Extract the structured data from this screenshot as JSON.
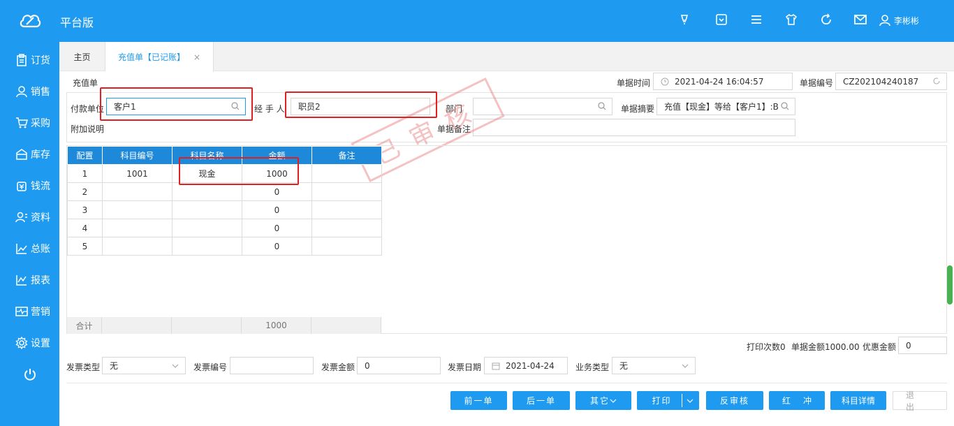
{
  "app": {
    "title": "平台版",
    "user_name": "李彬彬"
  },
  "sidebar": {
    "items": [
      {
        "label": "订货",
        "icon": "clipboard-icon"
      },
      {
        "label": "销售",
        "icon": "user-icon"
      },
      {
        "label": "采购",
        "icon": "cart-icon"
      },
      {
        "label": "库存",
        "icon": "warehouse-icon"
      },
      {
        "label": "钱流",
        "icon": "money-icon"
      },
      {
        "label": "资料",
        "icon": "contacts-icon"
      },
      {
        "label": "总账",
        "icon": "line-chart-icon"
      },
      {
        "label": "报表",
        "icon": "report-icon"
      },
      {
        "label": "营销",
        "icon": "pulse-icon"
      },
      {
        "label": "设置",
        "icon": "gear-icon"
      }
    ]
  },
  "tabs": {
    "home": "主页",
    "active": "充值单【已记账】",
    "close": "×"
  },
  "form": {
    "section_title": "充值单",
    "time_label": "单据时间",
    "time_value": "2021-04-24 16:04:57",
    "number_label": "单据编号",
    "number_value": "CZ202104240187",
    "payer_label": "付款单位",
    "payer_value": "客户1",
    "handler_label": "经 手 人",
    "handler_value": "职员2",
    "dept_label": "部门",
    "dept_value": "",
    "summary_label": "单据摘要",
    "summary_value": "充值【现金】等给【客户1】:B",
    "extra_label": "附加说明",
    "extra_value": "",
    "remark_label": "单据备注",
    "remark_value": "",
    "stamp_text": "已审核"
  },
  "grid": {
    "headers": [
      "配置",
      "科目编号",
      "科目名称",
      "金额",
      "备注"
    ],
    "rows": [
      [
        "1",
        "1001",
        "现金",
        "1000",
        ""
      ],
      [
        "2",
        "",
        "",
        "0",
        ""
      ],
      [
        "3",
        "",
        "",
        "0",
        ""
      ],
      [
        "4",
        "",
        "",
        "0",
        ""
      ],
      [
        "5",
        "",
        "",
        "0",
        ""
      ]
    ],
    "sum_label": "合计",
    "sum_amount": "1000"
  },
  "summary": {
    "print_count": "打印次数0",
    "total_amount": "单据金额1000.00",
    "discount_label": "优惠金额",
    "discount_value": "0"
  },
  "invoice": {
    "type_label": "发票类型",
    "type_value": "无",
    "number_label": "发票编号",
    "number_value": "",
    "amount_label": "发票金额",
    "amount_value": "0",
    "date_label": "发票日期",
    "date_value": "2021-04-24",
    "biz_label": "业务类型",
    "biz_value": "无"
  },
  "buttons": {
    "prev": "前一单",
    "next": "后一单",
    "other": "其它",
    "print": "打印",
    "unaudit": "反审核",
    "reverse": "红冲",
    "detail": "科目详情",
    "exit": "退出"
  },
  "colors": {
    "primary": "#1e9bf0",
    "grid_header": "#1e88d9",
    "highlight": "#e02020"
  }
}
